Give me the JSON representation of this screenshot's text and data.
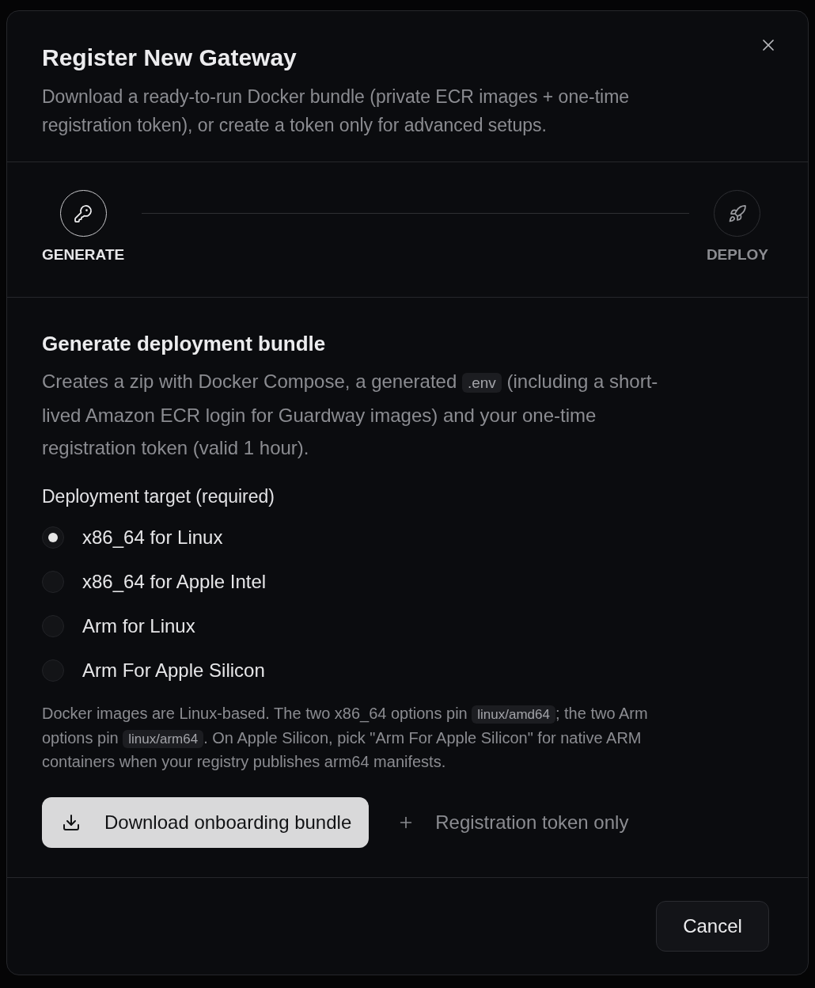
{
  "dialog": {
    "title": "Register New Gateway",
    "description": "Download a ready-to-run Docker bundle (private ECR images + one-time registration token), or create a token only for advanced setups."
  },
  "steps": [
    {
      "label": "GENERATE",
      "selected": true
    },
    {
      "label": "DEPLOY",
      "selected": false
    }
  ],
  "section": {
    "title": "Generate deployment bundle",
    "description": [
      {
        "kind": "text",
        "text": "Creates a zip with Docker Compose, a generated "
      },
      {
        "kind": "code",
        "text": ".env"
      },
      {
        "kind": "text",
        "text": " (including a short-lived Amazon ECR login for Guardway images) and your one-time registration token (valid 1 hour)."
      }
    ]
  },
  "target": {
    "label": "Deployment target (required)",
    "options": [
      {
        "label": "x86_64 for Linux",
        "selected": true
      },
      {
        "label": "x86_64 for Apple Intel",
        "selected": false
      },
      {
        "label": "Arm for Linux",
        "selected": false
      },
      {
        "label": "Arm For Apple Silicon",
        "selected": false
      }
    ]
  },
  "note": [
    {
      "kind": "text",
      "text": "Docker images are Linux-based. The two x86_64 options pin "
    },
    {
      "kind": "code",
      "text": "linux/amd64"
    },
    {
      "kind": "text",
      "text": "; the two Arm options pin "
    },
    {
      "kind": "code",
      "text": "linux/arm64"
    },
    {
      "kind": "text",
      "text": ". On Apple Silicon, pick \"Arm For Apple Silicon\" for native ARM containers when your registry publishes arm64 manifests."
    }
  ],
  "actions": [
    {
      "kind": "primary",
      "label": "Download onboarding bundle"
    },
    {
      "kind": "ghost",
      "label": "Registration token only"
    }
  ],
  "footer": {
    "cancel": "Cancel"
  }
}
